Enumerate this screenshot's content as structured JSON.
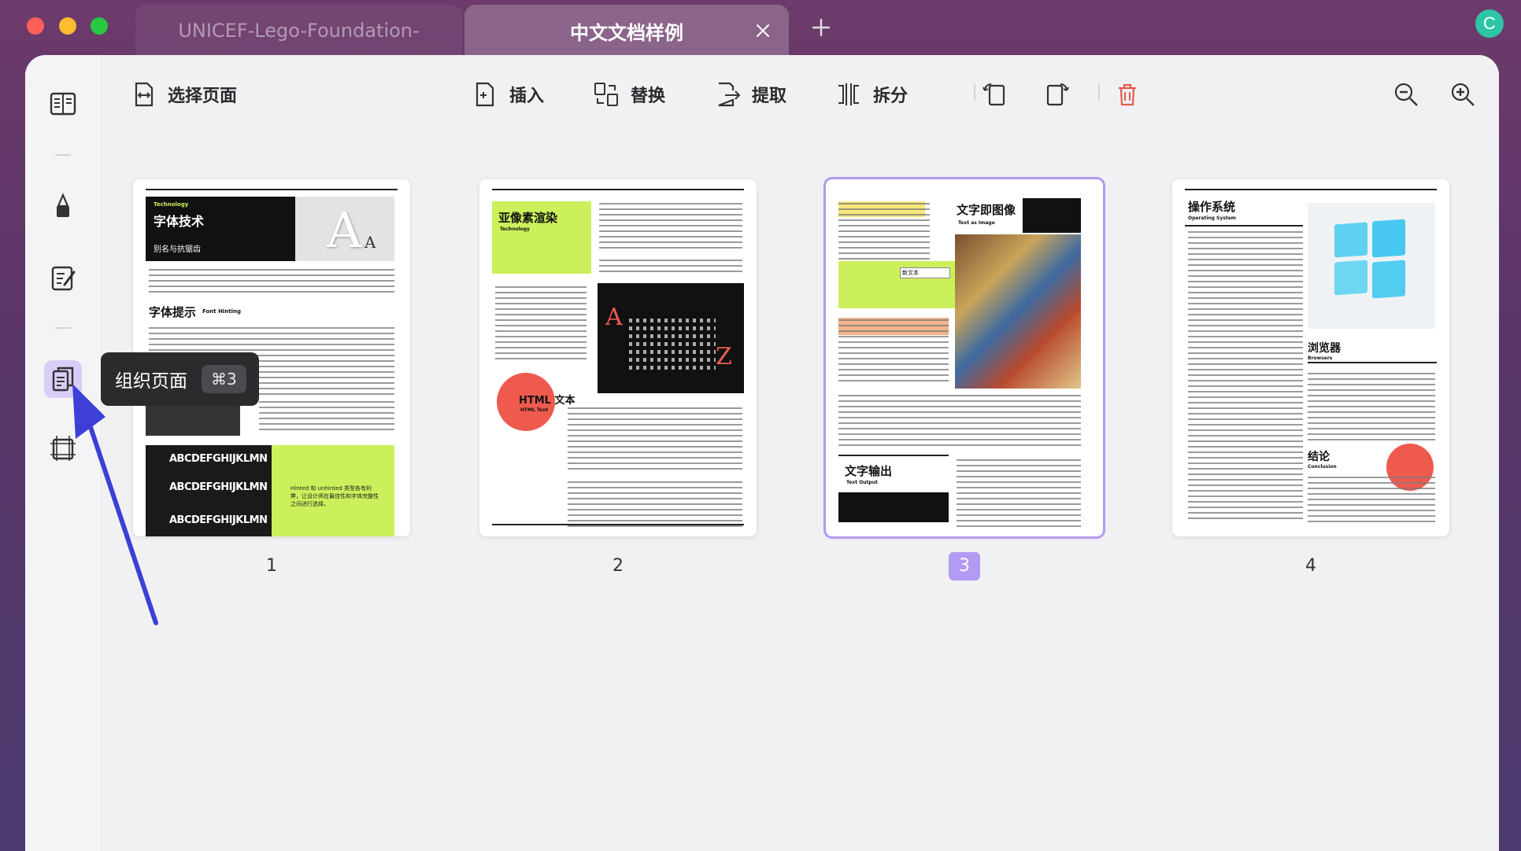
{
  "window": {
    "tabs": [
      {
        "label": "UNICEF-Lego-Foundation-",
        "active": false
      },
      {
        "label": "中文文档样例",
        "active": true
      }
    ],
    "avatar_letter": "C"
  },
  "toolbar": {
    "select_pages": "选择页面",
    "insert": "插入",
    "replace": "替换",
    "extract": "提取",
    "split": "拆分"
  },
  "sidebar": {
    "items": [
      {
        "name": "reader",
        "icon": "book-icon"
      },
      {
        "name": "highlight",
        "icon": "highlighter-icon"
      },
      {
        "name": "edit",
        "icon": "edit-icon"
      },
      {
        "name": "organize",
        "icon": "organize-pages-icon",
        "active": true
      },
      {
        "name": "crop",
        "icon": "crop-icon"
      }
    ]
  },
  "tooltip": {
    "label": "组织页面",
    "shortcut": "⌘3"
  },
  "pages": [
    {
      "number": "1",
      "tag": "Technology",
      "title": "字体技术",
      "subtitle": "别名与抗锯齿",
      "section": "字体提示",
      "section_en": "Font Hinting",
      "sample": "ABCDEFGHIJKLMN",
      "caption": "Hinted 和 unhinted 类型各有利弊，让设计师在最佳性和字体完整性之间进行选择。"
    },
    {
      "number": "2",
      "title": "亚像素渲染",
      "title_en": "Technology",
      "section": "HTML 文本",
      "section_en": "HTML Text",
      "letter_a": "A",
      "letter_z": "Z"
    },
    {
      "number": "3",
      "selected": true,
      "title": "文字即图像",
      "title_en": "Text as Image",
      "section": "文字输出",
      "section_en": "Text Output",
      "field": "新文本"
    },
    {
      "number": "4",
      "title": "操作系统",
      "title_en": "Operating System",
      "section": "浏览器",
      "section_en": "Browsers",
      "conclusion": "结论",
      "conclusion_en": "Conclusion"
    }
  ],
  "colors": {
    "accent": "#b39af2",
    "lime": "#ccf05b",
    "coral": "#ef5a4f",
    "delete": "#e45a4a"
  }
}
